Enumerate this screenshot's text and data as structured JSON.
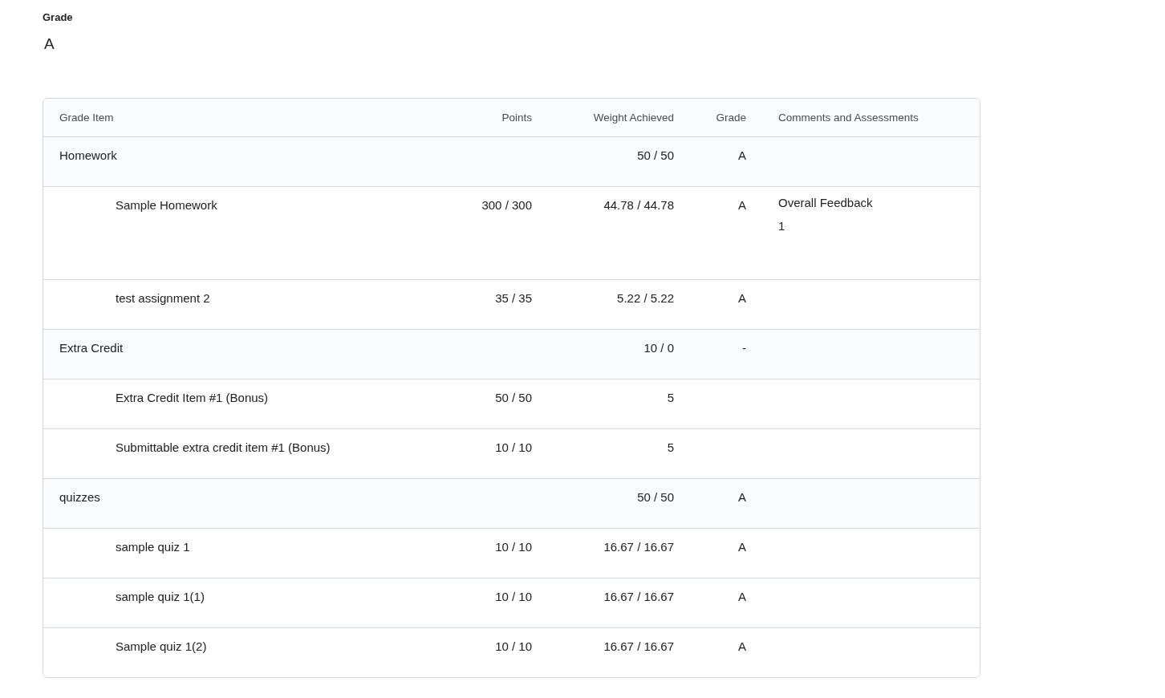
{
  "final_grade": {
    "label": "Grade",
    "value": "A"
  },
  "table": {
    "columns": [
      "Grade Item",
      "Points",
      "Weight Achieved",
      "Grade",
      "Comments and Assessments"
    ],
    "rows": [
      {
        "kind": "category",
        "name": "Homework",
        "weight": "50 / 50",
        "grade": "A"
      },
      {
        "kind": "item",
        "name": "Sample Homework",
        "points": "300 / 300",
        "weight": "44.78 / 44.78",
        "grade": "A",
        "comments": {
          "title": "Overall Feedback",
          "body": "1"
        }
      },
      {
        "kind": "item",
        "name": "test assignment 2",
        "points": "35 / 35",
        "weight": "5.22 / 5.22",
        "grade": "A"
      },
      {
        "kind": "category",
        "name": "Extra Credit",
        "weight": "10 / 0",
        "grade": "-"
      },
      {
        "kind": "item",
        "name": "Extra Credit Item #1 (Bonus)",
        "points": "50 / 50",
        "weight": "5"
      },
      {
        "kind": "item",
        "name": "Submittable extra credit item #1 (Bonus)",
        "points": "10 / 10",
        "weight": "5"
      },
      {
        "kind": "category",
        "name": "quizzes",
        "weight": "50 / 50",
        "grade": "A"
      },
      {
        "kind": "item",
        "name": "sample quiz 1",
        "points": "10 / 10",
        "weight": "16.67 / 16.67",
        "grade": "A"
      },
      {
        "kind": "item",
        "name": "sample quiz 1(1)",
        "points": "10 / 10",
        "weight": "16.67 / 16.67",
        "grade": "A"
      },
      {
        "kind": "item",
        "name": "Sample quiz 1(2)",
        "points": "10 / 10",
        "weight": "16.67 / 16.67",
        "grade": "A"
      }
    ]
  }
}
